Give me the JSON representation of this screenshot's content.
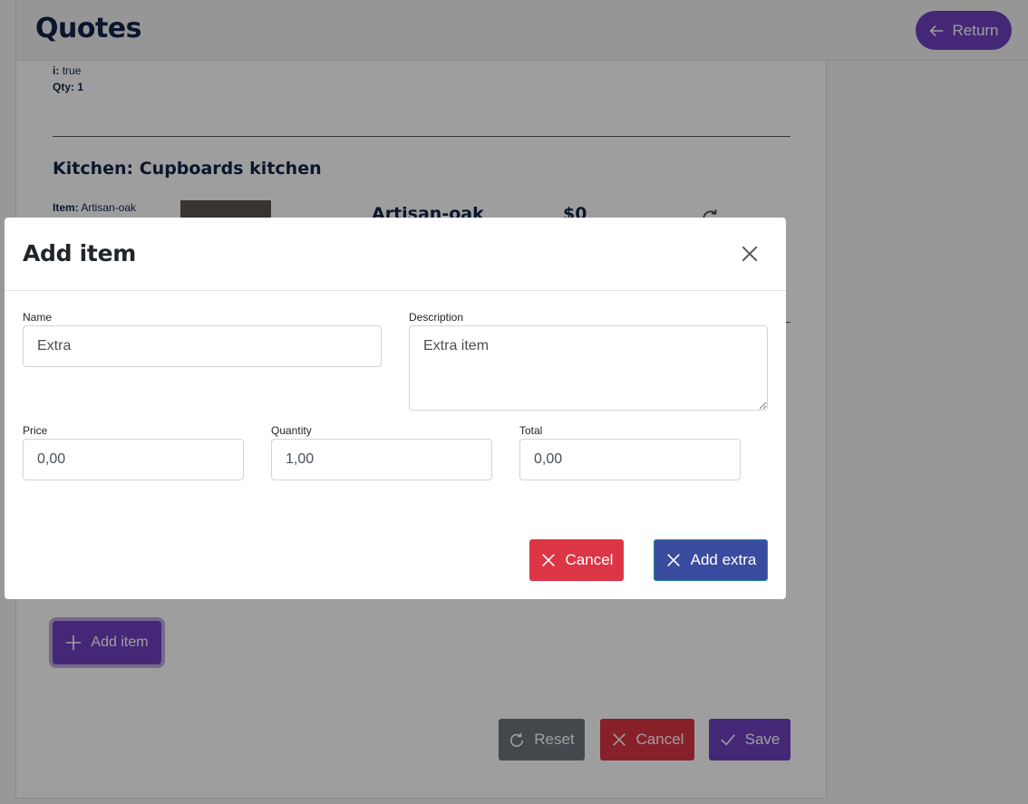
{
  "page": {
    "title": "Quotes",
    "return_label": "Return",
    "prev_item": {
      "line1_key": "i:",
      "line1_value": "true",
      "line2": "Qty: 1"
    },
    "section_title": "Kitchen: Cupboards kitchen",
    "item": {
      "label_key": "Item:",
      "label_value": "Artisan-oak",
      "name": "Artisan-oak",
      "price": "$0"
    },
    "add_item_label": "Add item",
    "footer": {
      "reset_label": "Reset",
      "cancel_label": "Cancel",
      "save_label": "Save"
    }
  },
  "modal": {
    "title": "Add item",
    "name_label": "Name",
    "name_value": "Extra",
    "description_label": "Description",
    "description_value": "Extra item",
    "price_label": "Price",
    "price_value": "0,00",
    "quantity_label": "Quantity",
    "quantity_value": "1,00",
    "total_label": "Total",
    "total_value": "0,00",
    "cancel_label": "Cancel",
    "add_label": "Add extra"
  },
  "colors": {
    "primary_purple": "#6f42c1",
    "danger": "#dc3545",
    "secondary": "#6c757d",
    "add_extra": "#3a4ba0",
    "title_navy": "#12254a"
  },
  "icons": [
    "arrow-left-icon",
    "plus-icon",
    "refresh-icon",
    "x-icon",
    "check-icon",
    "close-icon"
  ]
}
